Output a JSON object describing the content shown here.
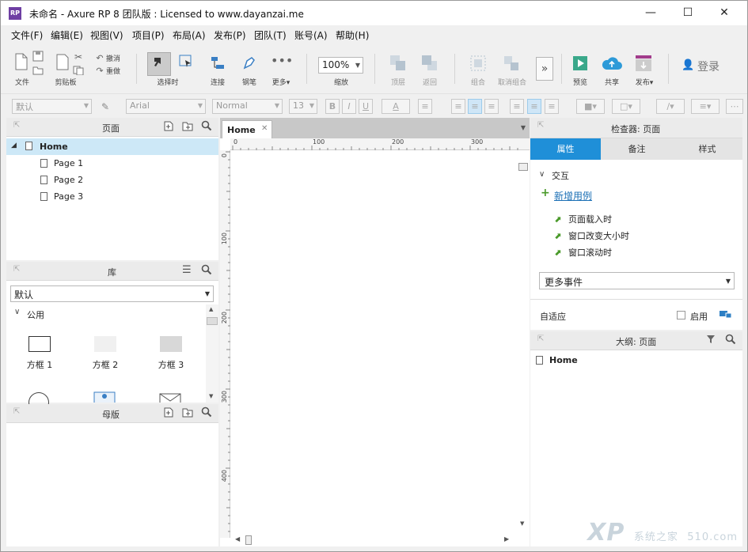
{
  "window": {
    "title": "未命名 - Axure RP 8 团队版 : Licensed to www.dayanzai.me",
    "logo": "RP",
    "controls": {
      "minimize": "—",
      "maximize": "☐",
      "close": "✕"
    }
  },
  "menu": [
    "文件(F)",
    "编辑(E)",
    "视图(V)",
    "项目(P)",
    "布局(A)",
    "发布(P)",
    "团队(T)",
    "账号(A)",
    "帮助(H)"
  ],
  "toolbar": {
    "file": "文件",
    "clipboard": "剪贴板",
    "undo": "撤消",
    "redo": "重做",
    "select_mode": "选择时",
    "connect": "连接",
    "pen": "钢笔",
    "more": "更多▾",
    "zoom_value": "100%",
    "zoom_label": "缩放",
    "top": "顶层",
    "back": "返回",
    "group": "组合",
    "ungroup": "取消组合",
    "preview": "预览",
    "share": "共享",
    "publish": "发布▾",
    "login": "登录"
  },
  "format": {
    "style": "默认",
    "font": "Arial",
    "weight": "Normal",
    "size": "13",
    "bold": "B",
    "italic": "I",
    "underline": "U",
    "font_color": "A"
  },
  "pages_panel": {
    "title": "页面",
    "items": [
      {
        "label": "Home",
        "level": 0,
        "selected": true
      },
      {
        "label": "Page 1",
        "level": 1
      },
      {
        "label": "Page 2",
        "level": 1
      },
      {
        "label": "Page 3",
        "level": 1
      }
    ]
  },
  "library_panel": {
    "title": "库",
    "selected_library": "默认",
    "category": "公用",
    "widgets": [
      "方框 1",
      "方框 2",
      "方框 3"
    ]
  },
  "masters_panel": {
    "title": "母版"
  },
  "canvas": {
    "tab_label": "Home",
    "ruler_h": [
      "0",
      "100",
      "200",
      "300"
    ],
    "ruler_v": [
      "0",
      "100",
      "200",
      "300",
      "400"
    ]
  },
  "inspector": {
    "title": "检查器: 页面",
    "tabs": [
      "属性",
      "备注",
      "样式"
    ],
    "active_tab": "属性",
    "section": "交互",
    "add_case": "新增用例",
    "events": [
      "页面载入时",
      "窗口改变大小时",
      "窗口滚动时"
    ],
    "more_events": "更多事件",
    "adaptive": "自适应",
    "enable": "启用"
  },
  "outline_panel": {
    "title": "大纲: 页面",
    "root": "Home"
  },
  "watermark": {
    "brand": "XP",
    "site": "510.com",
    "tag": "系统之家"
  },
  "colors": {
    "accent": "#1f8fd8",
    "selection": "#cde8f7",
    "logo": "#6e3fa3",
    "event_icon": "#4a9a2a",
    "publish": "#a23c8c"
  }
}
